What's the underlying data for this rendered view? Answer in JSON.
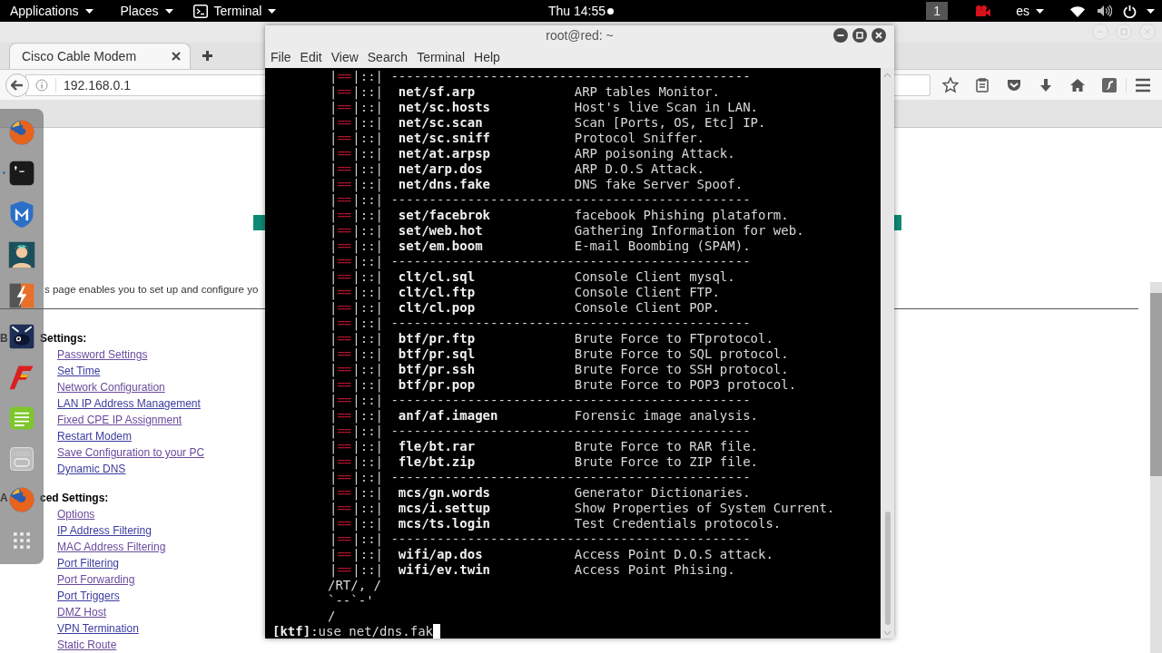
{
  "top_bar": {
    "menus": [
      {
        "label": "Applications"
      },
      {
        "label": "Places"
      },
      {
        "label": "Terminal"
      }
    ],
    "clock": "Thu 14:55",
    "workspace": "1",
    "keyboard_layout": "es"
  },
  "dock": [
    {
      "kind": "browser",
      "running": false
    },
    {
      "kind": "terminal",
      "running": true
    },
    {
      "kind": "shield",
      "running": false
    },
    {
      "kind": "figure",
      "running": false
    },
    {
      "kind": "bolt",
      "running": false
    },
    {
      "kind": "beast",
      "running": false
    },
    {
      "kind": "flame",
      "running": false
    },
    {
      "kind": "notes",
      "running": false
    },
    {
      "kind": "keypad",
      "running": false
    },
    {
      "kind": "browser",
      "running": false
    },
    {
      "kind": "grid",
      "running": false
    }
  ],
  "browser": {
    "tabs": [
      {
        "label": "Cisco Cable Modem",
        "selected": true
      }
    ],
    "url": "192.168.0.1",
    "page": {
      "intro": "s page enables you to set up and configure yo",
      "sections": [
        {
          "lead": "B",
          "heading": "Settings:",
          "links": [
            "Password Settings",
            "Set Time",
            "Network Configuration",
            "LAN IP Address Management",
            "Fixed CPE IP Assignment",
            "Restart Modem",
            "Save Configuration to your PC",
            "Dynamic DNS"
          ]
        },
        {
          "lead": "A",
          "heading": "ced Settings:",
          "links": [
            "Options",
            "IP Address Filtering",
            "MAC Address Filtering",
            "Port Filtering",
            "Port Forwarding",
            "Port Triggers",
            "DMZ Host",
            "VPN Termination",
            "Static Route"
          ]
        }
      ]
    }
  },
  "terminal": {
    "title": "root@red: ~",
    "menu": [
      "File",
      "Edit",
      "View",
      "Search",
      "Terminal",
      "Help"
    ],
    "rows": [
      {
        "kind": "separator",
        "edge": "|",
        "bar": "==",
        "rail": "|::|",
        "text": "-----------------------------------------------"
      },
      {
        "kind": "command",
        "edge": "|",
        "bar": "==",
        "rail": "|::|",
        "command": "net/sf.arp",
        "description": "ARP tables Monitor."
      },
      {
        "kind": "command",
        "edge": "|",
        "bar": "==",
        "rail": "|::|",
        "command": "net/sc.hosts",
        "description": "Host's live Scan in LAN."
      },
      {
        "kind": "command",
        "edge": "|",
        "bar": "==",
        "rail": "|::|",
        "command": "net/sc.scan",
        "description": "Scan [Ports, OS, Etc] IP."
      },
      {
        "kind": "command",
        "edge": "|",
        "bar": "==",
        "rail": "|::|",
        "command": "net/sc.sniff",
        "description": "Protocol Sniffer."
      },
      {
        "kind": "command",
        "edge": "|",
        "bar": "==",
        "rail": "|::|",
        "command": "net/at.arpsp",
        "description": "ARP poisoning Attack."
      },
      {
        "kind": "command",
        "edge": "|",
        "bar": "==",
        "rail": "|::|",
        "command": "net/arp.dos",
        "description": "ARP D.O.S Attack."
      },
      {
        "kind": "command",
        "edge": "|",
        "bar": "==",
        "rail": "|::|",
        "command": "net/dns.fake",
        "description": "DNS fake Server Spoof."
      },
      {
        "kind": "separator",
        "edge": "|",
        "bar": "==",
        "rail": "|::|",
        "text": "-----------------------------------------------"
      },
      {
        "kind": "command",
        "edge": "|",
        "bar": "==",
        "rail": "|::|",
        "command": "set/facebrok",
        "description": "facebook Phishing plataform."
      },
      {
        "kind": "command",
        "edge": "|",
        "bar": "==",
        "rail": "|::|",
        "command": "set/web.hot",
        "description": "Gathering Information for web."
      },
      {
        "kind": "command",
        "edge": "|",
        "bar": "==",
        "rail": "|::|",
        "command": "set/em.boom",
        "description": "E-mail Boombing (SPAM)."
      },
      {
        "kind": "separator",
        "edge": "|",
        "bar": "==",
        "rail": "|::|",
        "text": "-----------------------------------------------"
      },
      {
        "kind": "command",
        "edge": "|",
        "bar": "==",
        "rail": "|::|",
        "command": "clt/cl.sql",
        "description": "Console Client mysql."
      },
      {
        "kind": "command",
        "edge": "|",
        "bar": "==",
        "rail": "|::|",
        "command": "clt/cl.ftp",
        "description": "Console Client FTP."
      },
      {
        "kind": "command",
        "edge": "|",
        "bar": "==",
        "rail": "|::|",
        "command": "clt/cl.pop",
        "description": "Console Client POP."
      },
      {
        "kind": "separator",
        "edge": "|",
        "bar": "==",
        "rail": "|::|",
        "text": "-----------------------------------------------"
      },
      {
        "kind": "command",
        "edge": "|",
        "bar": "==",
        "rail": "|::|",
        "command": "btf/pr.ftp",
        "description": "Brute Force to FTprotocol."
      },
      {
        "kind": "command",
        "edge": "|",
        "bar": "==",
        "rail": "|::|",
        "command": "btf/pr.sql",
        "description": "Brute Force to SQL protocol."
      },
      {
        "kind": "command",
        "edge": "|",
        "bar": "==",
        "rail": "|::|",
        "command": "btf/pr.ssh",
        "description": "Brute Force to SSH protocol."
      },
      {
        "kind": "command",
        "edge": "|",
        "bar": "==",
        "rail": "|::|",
        "command": "btf/pr.pop",
        "description": "Brute Force to POP3 protocol."
      },
      {
        "kind": "separator",
        "edge": "|",
        "bar": "==",
        "rail": "|::|",
        "text": "-----------------------------------------------"
      },
      {
        "kind": "command",
        "edge": "|",
        "bar": "==",
        "rail": "|::|",
        "command": "anf/af.imagen",
        "description": "Forensic image analysis."
      },
      {
        "kind": "separator",
        "edge": "|",
        "bar": "==",
        "rail": "|::|",
        "text": "-----------------------------------------------"
      },
      {
        "kind": "command",
        "edge": "|",
        "bar": "==",
        "rail": "|::|",
        "command": "fle/bt.rar",
        "description": "Brute Force to RAR file."
      },
      {
        "kind": "command",
        "edge": "|",
        "bar": "==",
        "rail": "|::|",
        "command": "fle/bt.zip",
        "description": "Brute Force to ZIP file."
      },
      {
        "kind": "separator",
        "edge": "|",
        "bar": "==",
        "rail": "|::|",
        "text": "-----------------------------------------------"
      },
      {
        "kind": "command",
        "edge": "|",
        "bar": "==",
        "rail": "|::|",
        "command": "mcs/gn.words",
        "description": "Generator Dictionaries."
      },
      {
        "kind": "command",
        "edge": "|",
        "bar": "==",
        "rail": "|::|",
        "command": "mcs/i.settup",
        "description": "Show Properties of System Current."
      },
      {
        "kind": "command",
        "edge": "|",
        "bar": "==",
        "rail": "|::|",
        "command": "mcs/ts.login",
        "description": "Test Credentials protocols."
      },
      {
        "kind": "separator",
        "edge": "|",
        "bar": "==",
        "rail": "|::|",
        "text": "-----------------------------------------------"
      },
      {
        "kind": "command",
        "edge": "|",
        "bar": "==",
        "rail": "|::|",
        "command": "wifi/ap.dos",
        "description": "Access Point D.O.S attack."
      },
      {
        "kind": "command",
        "edge": "|",
        "bar": "==",
        "rail": "|::|",
        "command": "wifi/ev.twin",
        "description": "Access Point Phising."
      }
    ],
    "tail": [
      "/RT/, /",
      "`--`-'",
      "/"
    ],
    "prompt": {
      "tag": "[ktf]",
      "input": ":use net/dns.fak"
    }
  }
}
